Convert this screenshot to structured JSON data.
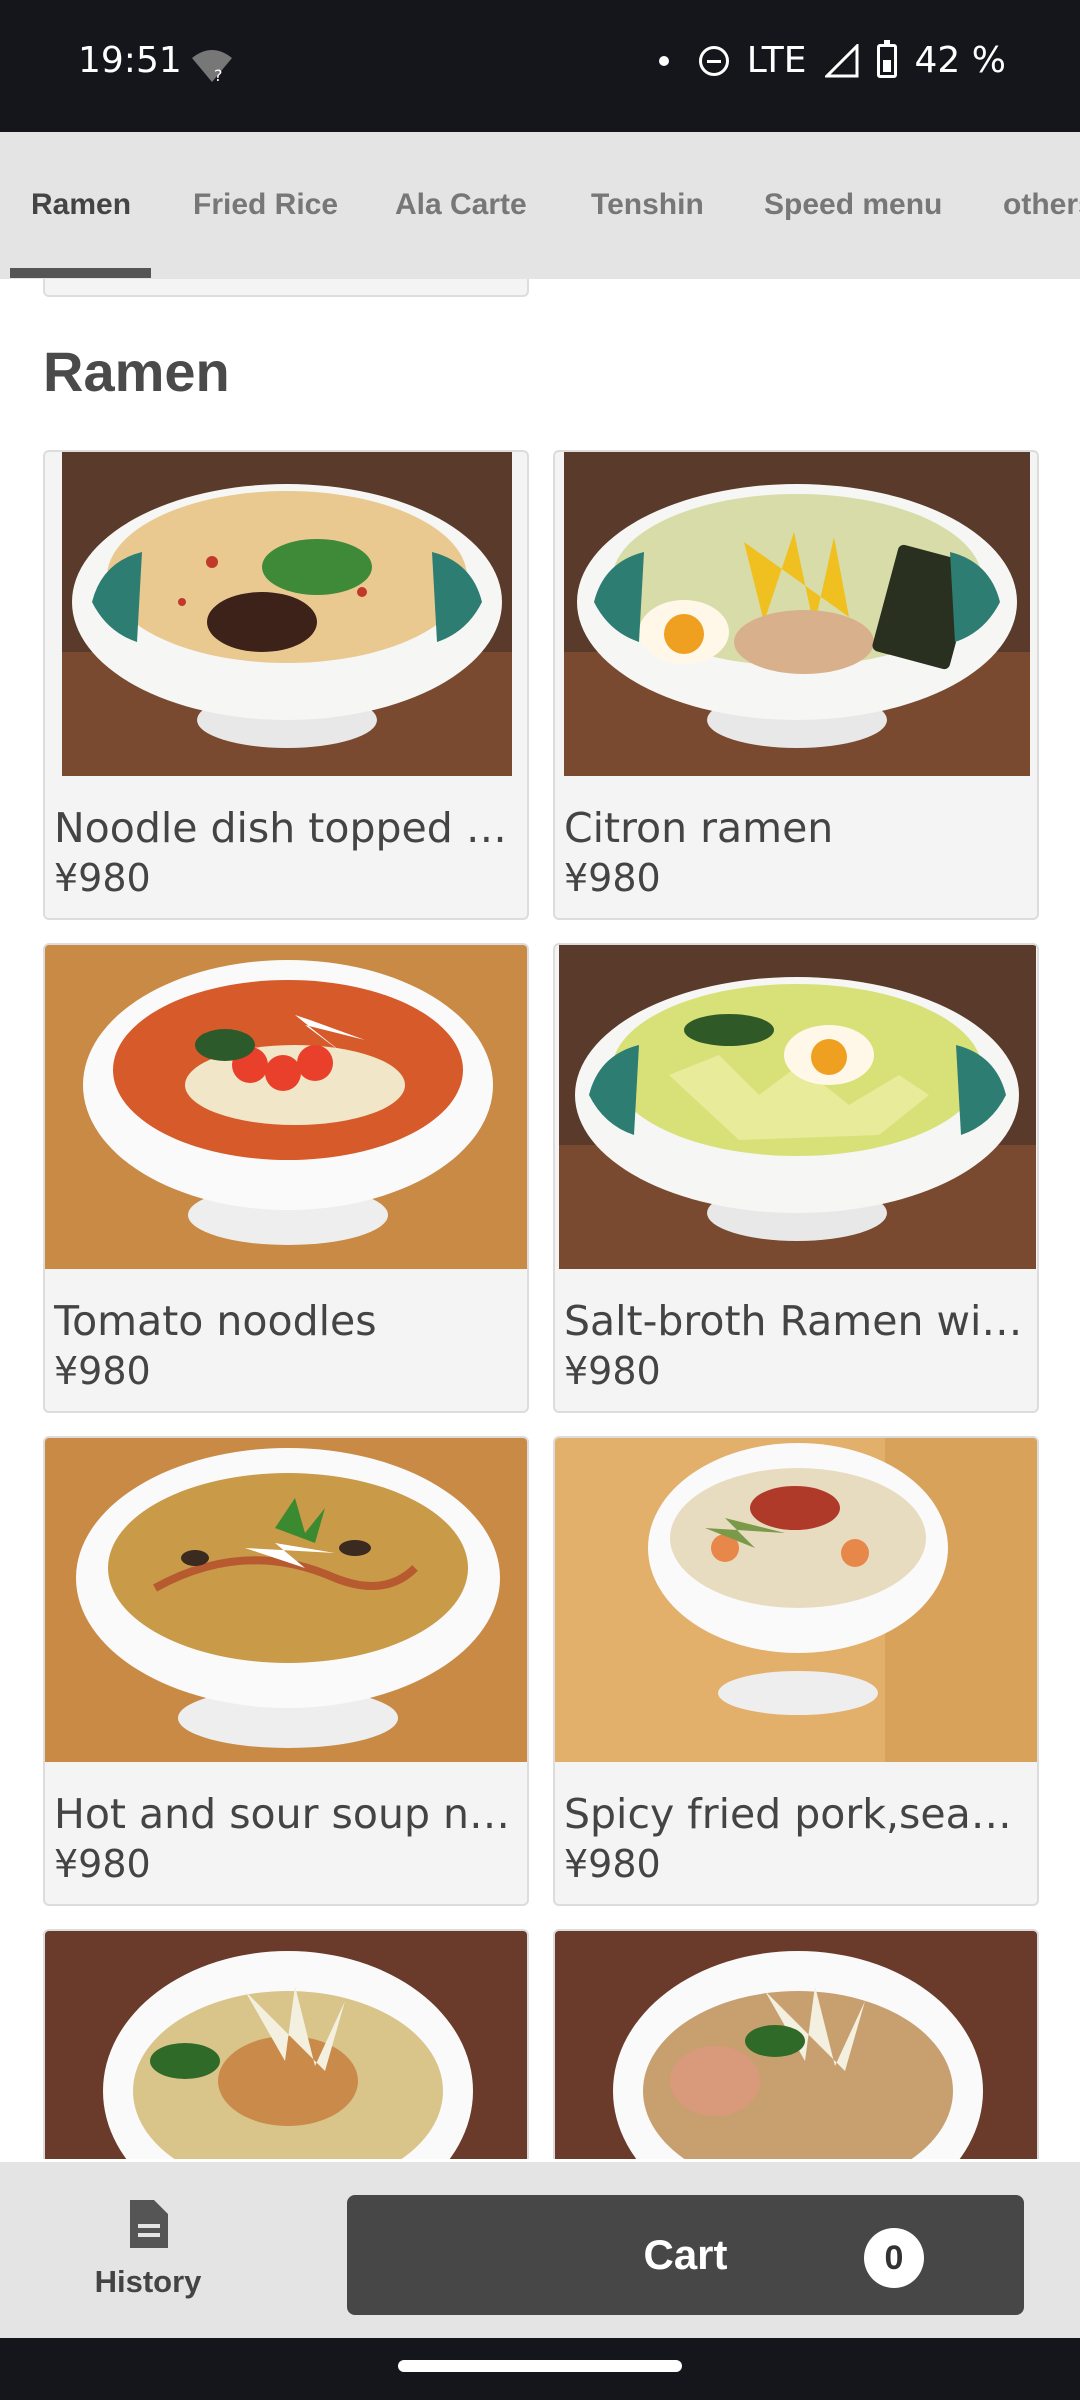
{
  "status_bar": {
    "time": "19:51",
    "network": "LTE",
    "battery": "42 %",
    "icons": [
      "wifi-unknown-icon",
      "dnd-icon",
      "signal-icon",
      "battery-icon"
    ]
  },
  "tabs": [
    {
      "label": "Ramen",
      "active": true
    },
    {
      "label": "Fried Rice",
      "active": false
    },
    {
      "label": "Ala Carte",
      "active": false
    },
    {
      "label": "Tenshin",
      "active": false
    },
    {
      "label": "Speed menu",
      "active": false
    },
    {
      "label": "others",
      "active": false
    }
  ],
  "section": {
    "title": "Ramen"
  },
  "items": [
    {
      "name": "Noodle dish topped wit…",
      "price": "¥980"
    },
    {
      "name": "Citron ramen",
      "price": "¥980"
    },
    {
      "name": "Tomato noodles",
      "price": "¥980"
    },
    {
      "name": "Salt-broth Ramen with s…",
      "price": "¥980"
    },
    {
      "name": "Hot and sour soup nood…",
      "price": "¥980"
    },
    {
      "name": "Spicy fried pork,seafoo…",
      "price": "¥980"
    }
  ],
  "bottom_bar": {
    "history_label": "History",
    "cart_label": "Cart",
    "cart_count": "0"
  },
  "colors": {
    "status_bar_bg": "#14161c",
    "tab_bar_bg": "#e4e4e4",
    "cart_button_bg": "#474747",
    "card_bg": "#f4f4f4"
  }
}
